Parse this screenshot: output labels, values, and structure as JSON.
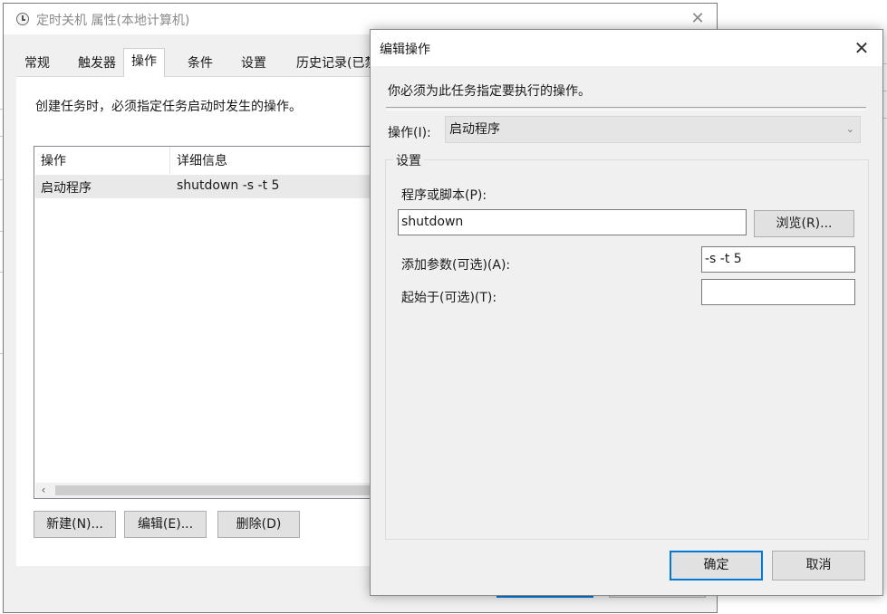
{
  "background_window": {
    "title": "定时关机 属性(本地计算机)",
    "close_symbol": "✕",
    "tabs": [
      "常规",
      "触发器",
      "操作",
      "条件",
      "设置",
      "历史记录(已禁"
    ],
    "active_tab": "操作",
    "instruction": "创建任务时，必须指定任务启动时发生的操作。",
    "table": {
      "columns": [
        "操作",
        "详细信息"
      ],
      "rows": [
        {
          "action": "启动程序",
          "details": "shutdown -s -t 5"
        }
      ]
    },
    "scroll_left_symbol": "‹",
    "buttons": {
      "new": "新建(N)...",
      "edit": "编辑(E)...",
      "delete": "删除(D)"
    }
  },
  "dialog": {
    "title": "编辑操作",
    "close_symbol": "✕",
    "instruction": "你必须为此任务指定要执行的操作。",
    "action_label": "操作(I):",
    "action_value": "启动程序",
    "chevron_symbol": "⌄",
    "settings_legend": "设置",
    "program_label": "程序或脚本(P):",
    "program_value": "shutdown",
    "browse_label": "浏览(R)...",
    "args_label": "添加参数(可选)(A):",
    "args_value": "-s -t 5",
    "startin_label": "起始于(可选)(T):",
    "startin_value": "",
    "ok_label": "确定",
    "cancel_label": "取消"
  },
  "colors": {
    "accent": "#0078d7",
    "dialog_background": "#f0f0f0",
    "selected_row": "#e9e9e9"
  }
}
